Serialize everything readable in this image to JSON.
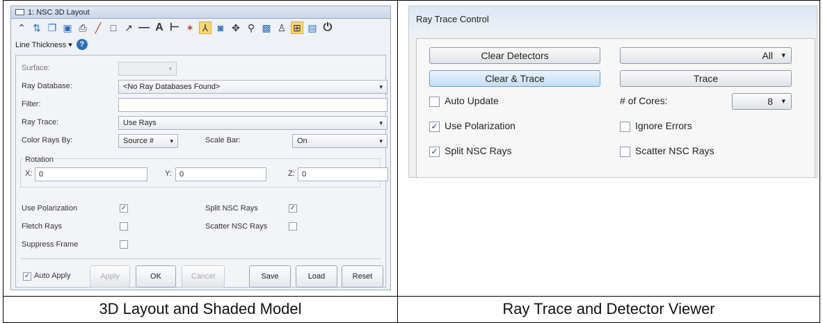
{
  "layout_window": {
    "title": "1: NSC 3D Layout",
    "line_thickness_label": "Line Thickness",
    "toolbar_icons": [
      "collapse-icon",
      "refresh-icon",
      "copy-icon",
      "save-icon",
      "print-icon",
      "pencil-icon",
      "rectangle-icon",
      "arrow-icon",
      "line-icon",
      "text-icon",
      "dimension-icon",
      "wizard-icon",
      "axes-icon",
      "zoom-window-icon",
      "pan-icon",
      "zoom-icon",
      "fit-icon",
      "lock-icon",
      "grid-icon",
      "window-icon",
      "power-icon"
    ],
    "text_tool_glyph": "A",
    "help_glyph": "?",
    "surface_label": "Surface:",
    "ray_database_label": "Ray Database:",
    "ray_database_value": "<No Ray Databases Found>",
    "filter_label": "Filter:",
    "filter_value": "",
    "ray_trace_label": "Ray Trace:",
    "ray_trace_value": "Use Rays",
    "color_rays_label": "Color Rays By:",
    "color_rays_value": "Source #",
    "scale_bar_label": "Scale Bar:",
    "scale_bar_value": "On",
    "rotation_label": "Rotation",
    "x_label": "X:",
    "x_value": "0",
    "y_label": "Y:",
    "y_value": "0",
    "z_label": "Z:",
    "z_value": "0",
    "use_polarization_label": "Use Polarization",
    "use_polarization_checked": true,
    "split_nsc_rays_label": "Split NSC Rays",
    "split_nsc_rays_checked": true,
    "fletch_rays_label": "Fletch Rays",
    "fletch_rays_checked": false,
    "scatter_nsc_rays_label": "Scatter NSC Rays",
    "scatter_nsc_rays_checked": false,
    "suppress_frame_label": "Suppress Frame",
    "suppress_frame_checked": false,
    "auto_apply_label": "Auto Apply",
    "auto_apply_checked": true,
    "apply_label": "Apply",
    "ok_label": "OK",
    "cancel_label": "Cancel",
    "save_label": "Save",
    "load_label": "Load",
    "reset_label": "Reset"
  },
  "ray_trace_control": {
    "title": "Ray Trace Control",
    "clear_detectors_label": "Clear Detectors",
    "detector_select_value": "All",
    "clear_trace_label": "Clear & Trace",
    "trace_label": "Trace",
    "auto_update_label": "Auto Update",
    "auto_update_checked": false,
    "cores_label": "# of Cores:",
    "cores_value": "8",
    "use_polarization_label": "Use Polarization",
    "use_polarization_checked": true,
    "ignore_errors_label": "Ignore Errors",
    "ignore_errors_checked": false,
    "split_nsc_rays_label": "Split NSC Rays",
    "split_nsc_rays_checked": true,
    "scatter_nsc_rays_label": "Scatter NSC Rays",
    "scatter_nsc_rays_checked": false
  },
  "captions": {
    "left": "3D Layout and Shaded Model",
    "right": "Ray Trace and Detector Viewer"
  },
  "checkmark_glyph": "✓",
  "dropdown_arrow_glyph": "▾"
}
